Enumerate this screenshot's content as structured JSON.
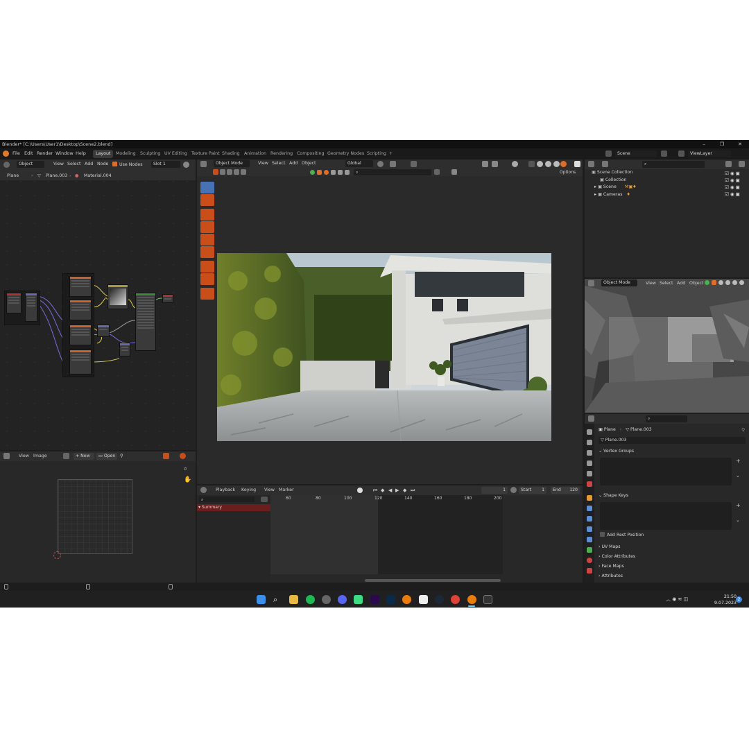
{
  "window": {
    "title": "Blender* [C:\\Users\\User1\\Desktop\\Scene2.blend]",
    "minimize_icon": "minimize-icon",
    "maximize_icon": "maximize-icon",
    "close_icon": "close-icon"
  },
  "menubar": {
    "items": [
      "File",
      "Edit",
      "Render",
      "Window",
      "Help"
    ],
    "workspaces": [
      "Layout",
      "Modeling",
      "Sculpting",
      "UV Editing",
      "Texture Paint",
      "Shading",
      "Animation",
      "Rendering",
      "Compositing",
      "Geometry Nodes",
      "Scripting"
    ],
    "active_workspace": "Layout",
    "add_workspace": "+",
    "scene_label": "Scene",
    "view_layer_label": "ViewLayer"
  },
  "node_editor": {
    "object_dropdown": "Object",
    "menus": [
      "View",
      "Select",
      "Add",
      "Node"
    ],
    "use_nodes": "Use Nodes",
    "slot": "Slot 1",
    "breadcrumb": [
      "Plane",
      "Plane.003",
      "Material.004"
    ]
  },
  "viewport": {
    "mode": "Object Mode",
    "menus": [
      "View",
      "Select",
      "Add",
      "Object"
    ],
    "transform": "Global",
    "options": "Options"
  },
  "image_editor": {
    "menus": [
      "View",
      "Image"
    ],
    "new_label": "New",
    "open_label": "Open"
  },
  "timeline": {
    "menus": [
      "Playback",
      "Keying",
      "View",
      "Marker"
    ],
    "current_frame": "1",
    "start_label": "Start",
    "start_value": "1",
    "end_label": "End",
    "end_value": "120",
    "summary": "Summary",
    "ticks": [
      "60",
      "80",
      "100",
      "120",
      "140",
      "160",
      "180",
      "200"
    ]
  },
  "outliner": {
    "rows": [
      "Scene Collection",
      "Collection",
      "Scene",
      "Cameras"
    ]
  },
  "viewport2": {
    "mode": "Object Mode",
    "menus": [
      "View",
      "Select",
      "Add",
      "Object"
    ]
  },
  "properties": {
    "breadcrumb": [
      "Plane",
      "Plane.003"
    ],
    "mesh_name": "Plane.003",
    "sections": [
      "Vertex Groups",
      "Shape Keys",
      "UV Maps",
      "Color Attributes",
      "Face Maps",
      "Attributes"
    ],
    "add_rest_position": "Add Rest Position"
  },
  "taskbar": {
    "time": "21:50",
    "date": "9.07.2023",
    "notification_count": "2",
    "icons": [
      "windows-start-icon",
      "search-icon",
      "file-explorer-icon",
      "spotify-icon",
      "chatgpt-icon",
      "discord-icon",
      "android-studio-icon",
      "premiere-pro-icon",
      "photoshop-icon",
      "blender-icon",
      "notion-icon",
      "steam-icon",
      "chrome-icon",
      "blender-active-icon",
      "terminal-icon"
    ]
  },
  "colors": {
    "accent_orange": "#e06e2b",
    "accent_blue": "#4772b3",
    "panel_bg": "#282828"
  }
}
